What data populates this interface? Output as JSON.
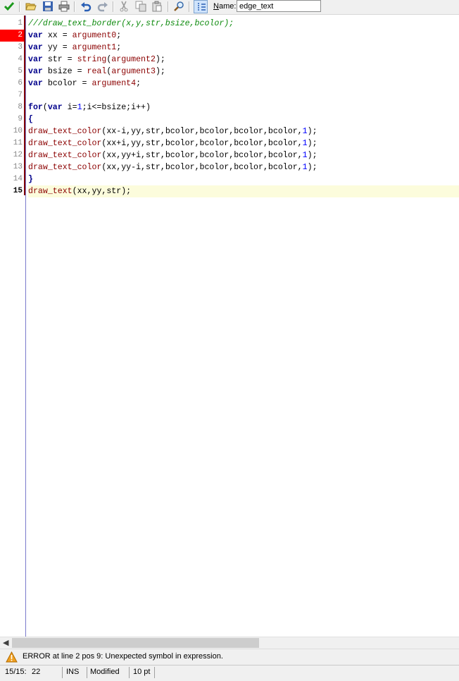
{
  "toolbar": {
    "name_label_first": "N",
    "name_label_rest": "ame:",
    "name_value": "edge_text",
    "icons": [
      "checkmark-icon",
      "open-folder-icon",
      "save-icon",
      "print-icon",
      "undo-icon",
      "redo-icon",
      "cut-icon",
      "copy-icon",
      "paste-icon",
      "find-icon",
      "indent-guide-icon"
    ]
  },
  "colors": {
    "comment": "#0d8a0d",
    "keyword": "#00008b",
    "function": "#8b0000",
    "number": "#0000ff",
    "error_line": "#ff0000",
    "current_line": "#fcfcdc"
  },
  "editor": {
    "error_line": 2,
    "current_line": 15,
    "lines": [
      {
        "num": "1",
        "tokens": [
          {
            "t": "comment",
            "v": "///draw_text_border(x,y,str,bsize,bcolor);"
          }
        ]
      },
      {
        "num": "2",
        "tokens": [
          {
            "t": "keyword",
            "v": "var"
          },
          {
            "t": "plain",
            "v": " xx = "
          },
          {
            "t": "func",
            "v": "argument0"
          },
          {
            "t": "plain",
            "v": ";"
          }
        ]
      },
      {
        "num": "3",
        "tokens": [
          {
            "t": "keyword",
            "v": "var"
          },
          {
            "t": "plain",
            "v": " yy = "
          },
          {
            "t": "func",
            "v": "argument1"
          },
          {
            "t": "plain",
            "v": ";"
          }
        ]
      },
      {
        "num": "4",
        "tokens": [
          {
            "t": "keyword",
            "v": "var"
          },
          {
            "t": "plain",
            "v": " str = "
          },
          {
            "t": "func",
            "v": "string"
          },
          {
            "t": "plain",
            "v": "("
          },
          {
            "t": "func",
            "v": "argument2"
          },
          {
            "t": "plain",
            "v": ");"
          }
        ]
      },
      {
        "num": "5",
        "tokens": [
          {
            "t": "keyword",
            "v": "var"
          },
          {
            "t": "plain",
            "v": " bsize = "
          },
          {
            "t": "func",
            "v": "real"
          },
          {
            "t": "plain",
            "v": "("
          },
          {
            "t": "func",
            "v": "argument3"
          },
          {
            "t": "plain",
            "v": ");"
          }
        ]
      },
      {
        "num": "6",
        "tokens": [
          {
            "t": "keyword",
            "v": "var"
          },
          {
            "t": "plain",
            "v": " bcolor = "
          },
          {
            "t": "func",
            "v": "argument4"
          },
          {
            "t": "plain",
            "v": ";"
          }
        ]
      },
      {
        "num": "7",
        "tokens": []
      },
      {
        "num": "8",
        "tokens": [
          {
            "t": "keyword",
            "v": "for"
          },
          {
            "t": "plain",
            "v": "("
          },
          {
            "t": "keyword",
            "v": "var"
          },
          {
            "t": "plain",
            "v": " i="
          },
          {
            "t": "number",
            "v": "1"
          },
          {
            "t": "plain",
            "v": ";i<=bsize;i++)"
          }
        ]
      },
      {
        "num": "9",
        "tokens": [
          {
            "t": "keyword",
            "v": "{"
          }
        ]
      },
      {
        "num": "10",
        "tokens": [
          {
            "t": "func",
            "v": "draw_text_color"
          },
          {
            "t": "plain",
            "v": "(xx-i,yy,str,bcolor,bcolor,bcolor,bcolor,"
          },
          {
            "t": "number",
            "v": "1"
          },
          {
            "t": "plain",
            "v": ");"
          }
        ]
      },
      {
        "num": "11",
        "tokens": [
          {
            "t": "func",
            "v": "draw_text_color"
          },
          {
            "t": "plain",
            "v": "(xx+i,yy,str,bcolor,bcolor,bcolor,bcolor,"
          },
          {
            "t": "number",
            "v": "1"
          },
          {
            "t": "plain",
            "v": ");"
          }
        ]
      },
      {
        "num": "12",
        "tokens": [
          {
            "t": "func",
            "v": "draw_text_color"
          },
          {
            "t": "plain",
            "v": "(xx,yy+i,str,bcolor,bcolor,bcolor,bcolor,"
          },
          {
            "t": "number",
            "v": "1"
          },
          {
            "t": "plain",
            "v": ");"
          }
        ]
      },
      {
        "num": "13",
        "tokens": [
          {
            "t": "func",
            "v": "draw_text_color"
          },
          {
            "t": "plain",
            "v": "(xx,yy-i,str,bcolor,bcolor,bcolor,bcolor,"
          },
          {
            "t": "number",
            "v": "1"
          },
          {
            "t": "plain",
            "v": ");"
          }
        ]
      },
      {
        "num": "14",
        "tokens": [
          {
            "t": "keyword",
            "v": "}"
          }
        ]
      },
      {
        "num": "15",
        "tokens": [
          {
            "t": "func",
            "v": "draw_text"
          },
          {
            "t": "plain",
            "v": "(xx,yy,str);"
          }
        ]
      }
    ]
  },
  "message": {
    "icon": "warning-icon",
    "text": "ERROR at line 2 pos 9: Unexpected symbol in expression."
  },
  "status": {
    "position": "15/15:",
    "column": "22",
    "mode": "INS",
    "modified": "Modified",
    "font_size": "10 pt"
  }
}
